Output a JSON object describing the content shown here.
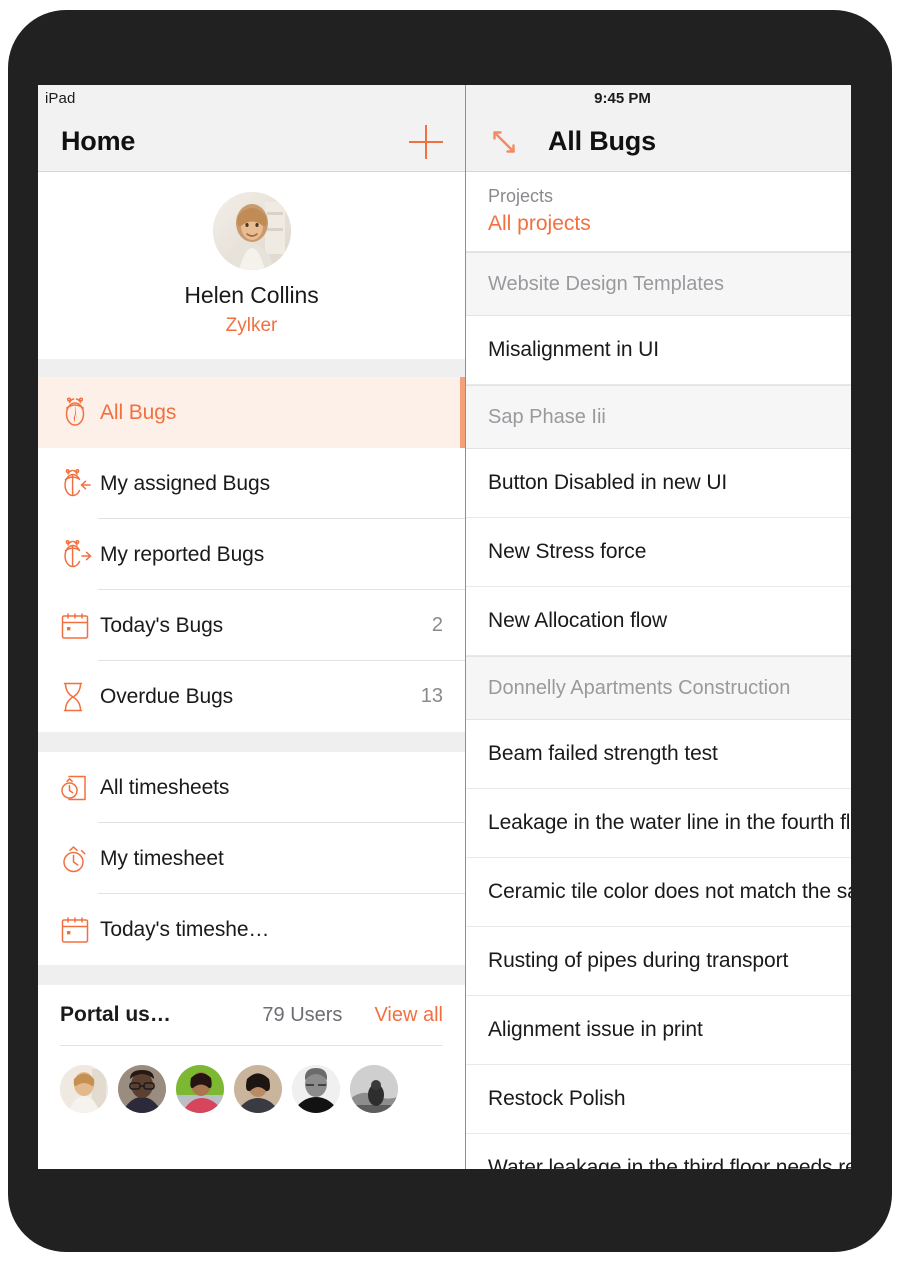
{
  "left_panel": {
    "status_bar": {
      "device_label": "iPad"
    },
    "nav": {
      "title": "Home",
      "add_icon": "plus-icon"
    },
    "profile": {
      "name": "Helen Collins",
      "org": "Zylker",
      "avatar_icon": "user-avatar"
    },
    "menu_groups": [
      {
        "items": [
          {
            "label": "All Bugs",
            "icon": "ladybug-icon",
            "count": "",
            "selected": true
          },
          {
            "label": "My assigned Bugs",
            "icon": "bug-assigned-icon",
            "count": "",
            "selected": false
          },
          {
            "label": "My reported Bugs",
            "icon": "bug-reported-icon",
            "count": "",
            "selected": false
          },
          {
            "label": "Today's Bugs",
            "icon": "calendar-icon",
            "count": "2",
            "selected": false
          },
          {
            "label": "Overdue Bugs",
            "icon": "hourglass-icon",
            "count": "13",
            "selected": false
          }
        ]
      },
      {
        "items": [
          {
            "label": "All timesheets",
            "icon": "timesheet-doc-icon",
            "count": "",
            "selected": false
          },
          {
            "label": "My timesheet",
            "icon": "stopwatch-icon",
            "count": "",
            "selected": false
          },
          {
            "label": "Today's timeshe…",
            "icon": "calendar-icon",
            "count": "",
            "selected": false
          }
        ]
      }
    ],
    "portal_users": {
      "title": "Portal us…",
      "count_label": "79 Users",
      "view_all_label": "View all",
      "avatars": [
        "user-1",
        "user-2",
        "user-3",
        "user-4",
        "user-5",
        "user-6"
      ]
    }
  },
  "right_panel": {
    "status_bar": {
      "time": "9:45 PM"
    },
    "nav": {
      "title": "All Bugs",
      "expand_icon": "expand-arrows-icon"
    },
    "projects_filter": {
      "label": "Projects",
      "value": "All projects"
    },
    "list": [
      {
        "type": "group",
        "label": "Website Design Templates"
      },
      {
        "type": "bug",
        "label": "Misalignment in UI"
      },
      {
        "type": "group",
        "label": "Sap Phase Iii"
      },
      {
        "type": "bug",
        "label": "Button Disabled in new UI"
      },
      {
        "type": "bug",
        "label": "New Stress force"
      },
      {
        "type": "bug",
        "label": "New Allocation flow"
      },
      {
        "type": "group",
        "label": "Donnelly Apartments Construction"
      },
      {
        "type": "bug",
        "label": "Beam failed strength test"
      },
      {
        "type": "bug",
        "label": "Leakage in the water line in the fourth floor"
      },
      {
        "type": "bug",
        "label": "Ceramic tile color does not match the sample"
      },
      {
        "type": "bug",
        "label": "Rusting of pipes during transport"
      },
      {
        "type": "bug",
        "label": "Alignment issue in print"
      },
      {
        "type": "bug",
        "label": "Restock Polish"
      },
      {
        "type": "bug",
        "label": "Water leakage in the third floor needs repair"
      }
    ]
  },
  "colors": {
    "accent": "#f2703f",
    "accent_soft": "#fdf0e9",
    "accent_edge": "#f4a07a",
    "bar_bg": "#f2f2f2",
    "group_bg": "#f6f6f7",
    "text": "#1a1a1c",
    "muted": "#8a8a8e",
    "bezel": "#212121"
  }
}
